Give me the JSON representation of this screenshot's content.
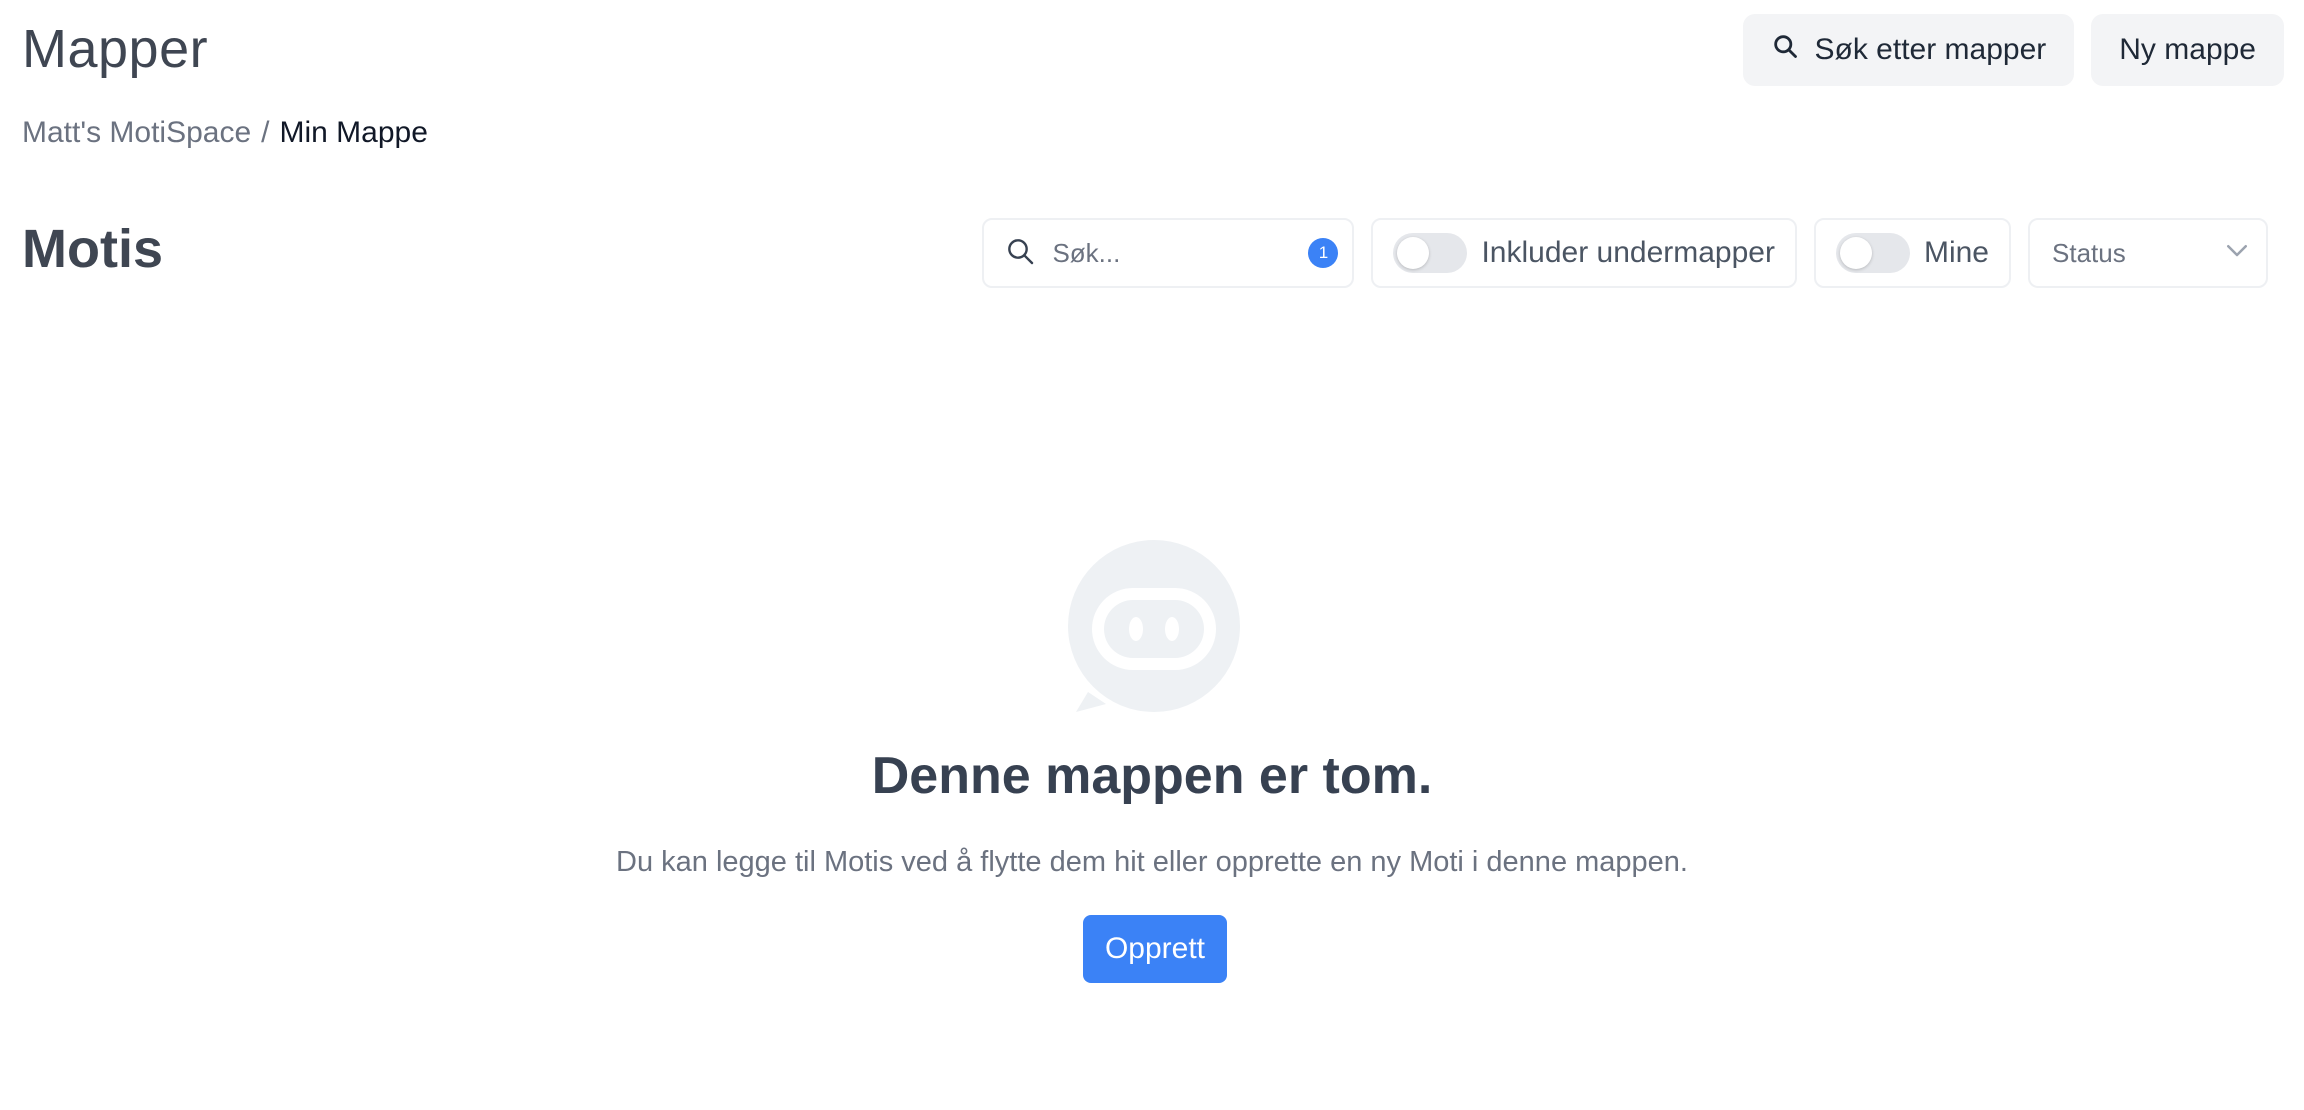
{
  "header": {
    "title": "Mapper",
    "search_folders_label": "Søk etter mapper",
    "new_folder_label": "Ny mappe"
  },
  "breadcrumb": {
    "workspace": "Matt's MotiSpace",
    "separator": "/",
    "current": "Min Mappe"
  },
  "section": {
    "title": "Motis",
    "search": {
      "placeholder": "Søk...",
      "value": "",
      "badge_count": "1"
    },
    "include_subfolders": {
      "label": "Inkluder undermapper",
      "on": false
    },
    "mine": {
      "label": "Mine",
      "on": false
    },
    "status": {
      "selected": "Status"
    }
  },
  "empty_state": {
    "icon": "moti-robot-chat-icon",
    "title": "Denne mappen er tom.",
    "description": "Du kan legge til Motis ved å flytte dem hit eller opprette en ny Moti i denne mappen.",
    "create_label": "Opprett"
  },
  "colors": {
    "accent": "#3b82f6",
    "chip_background": "#f3f4f6",
    "border": "#eef0f3",
    "icon_muted": "#eef1f4"
  }
}
